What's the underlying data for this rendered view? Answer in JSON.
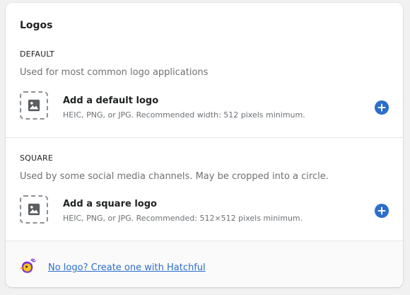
{
  "card": {
    "title": "Logos"
  },
  "default_section": {
    "heading": "DEFAULT",
    "description": "Used for most common logo applications",
    "item_title": "Add a default logo",
    "item_subtitle": "HEIC, PNG, or JPG. Recommended width: 512 pixels minimum.",
    "thumb_icon": "image-icon",
    "add_icon": "plus-circle-icon"
  },
  "square_section": {
    "heading": "SQUARE",
    "description": "Used by some social media channels. May be cropped into a circle.",
    "item_title": "Add a square logo",
    "item_subtitle": "HEIC, PNG, or JPG. Recommended: 512×512 pixels minimum.",
    "thumb_icon": "image-icon",
    "add_icon": "plus-circle-icon"
  },
  "footer": {
    "mascot_icon": "hatchful-bird-icon",
    "link_text": "No logo? Create one with Hatchful"
  },
  "colors": {
    "accent": "#2c6ecb",
    "mascot_yellow": "#f5c518",
    "mascot_purple": "#7b2bd4"
  }
}
